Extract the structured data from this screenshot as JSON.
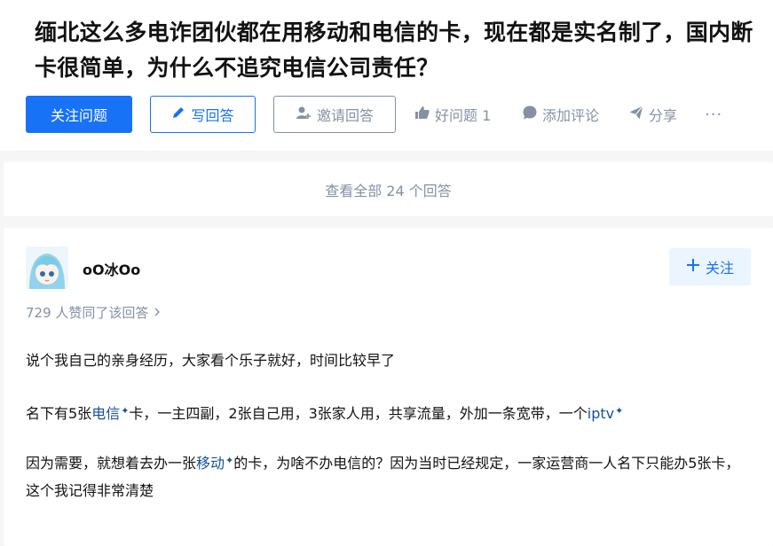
{
  "question": {
    "title": "缅北这么多电诈团伙都在用移动和电信的卡，现在都是实名制了，国内断卡很简单，为什么不追究电信公司责任？",
    "follow_label": "关注问题",
    "write_label": "写回答",
    "invite_label": "邀请回答",
    "good_question_label": "好问题 1",
    "comment_label": "添加评论",
    "share_label": "分享",
    "more_label": "···"
  },
  "view_all": "查看全部 24 个回答",
  "answer": {
    "author_name": "oO冰Oo",
    "follow_label": "关注",
    "vote_text": "729 人赞同了该回答",
    "p1": "说个我自己的亲身经历，大家看个乐子就好，时间比较早了",
    "p2_a": "名下有5张",
    "p2_kw1": "电信",
    "p2_b": "卡，一主四副，2张自己用，3张家人用，共享流量，外加一条宽带，一个",
    "p2_kw2": "iptv",
    "p3_a": "因为需要，就想着去办一张",
    "p3_kw": "移动",
    "p3_b": "的卡，为啥不办电信的？因为当时已经规定，一家运营商一人名下只能办5张卡，这个我记得非常清楚"
  },
  "colors": {
    "brand": "#1772f6",
    "muted": "#8491a5",
    "link": "#175199"
  }
}
